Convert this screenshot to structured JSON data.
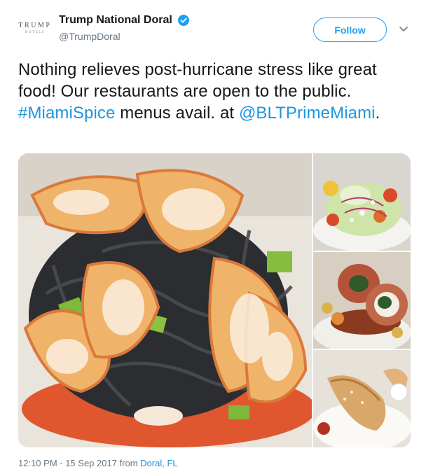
{
  "account": {
    "display_name": "Trump National Doral",
    "handle": "@TrumpDoral",
    "avatar_brand": "TRUMP",
    "avatar_sub": "HOTELS",
    "verified": true
  },
  "follow_label": "Follow",
  "tweet": {
    "text_part1": "Nothing relieves post-hurricane stress like great food! Our restaurants are open to the public. ",
    "hashtag": "#MiamiSpice",
    "text_part2": " menus avail. at ",
    "mention": "@BLTPrimeMiami",
    "text_part3": "."
  },
  "meta": {
    "timestamp": "12:10 PM - 15 Sep 2017 from ",
    "location": "Doral, FL"
  },
  "colors": {
    "accent": "#1da1f2",
    "link": "#1b95e0",
    "muted": "#657786"
  }
}
